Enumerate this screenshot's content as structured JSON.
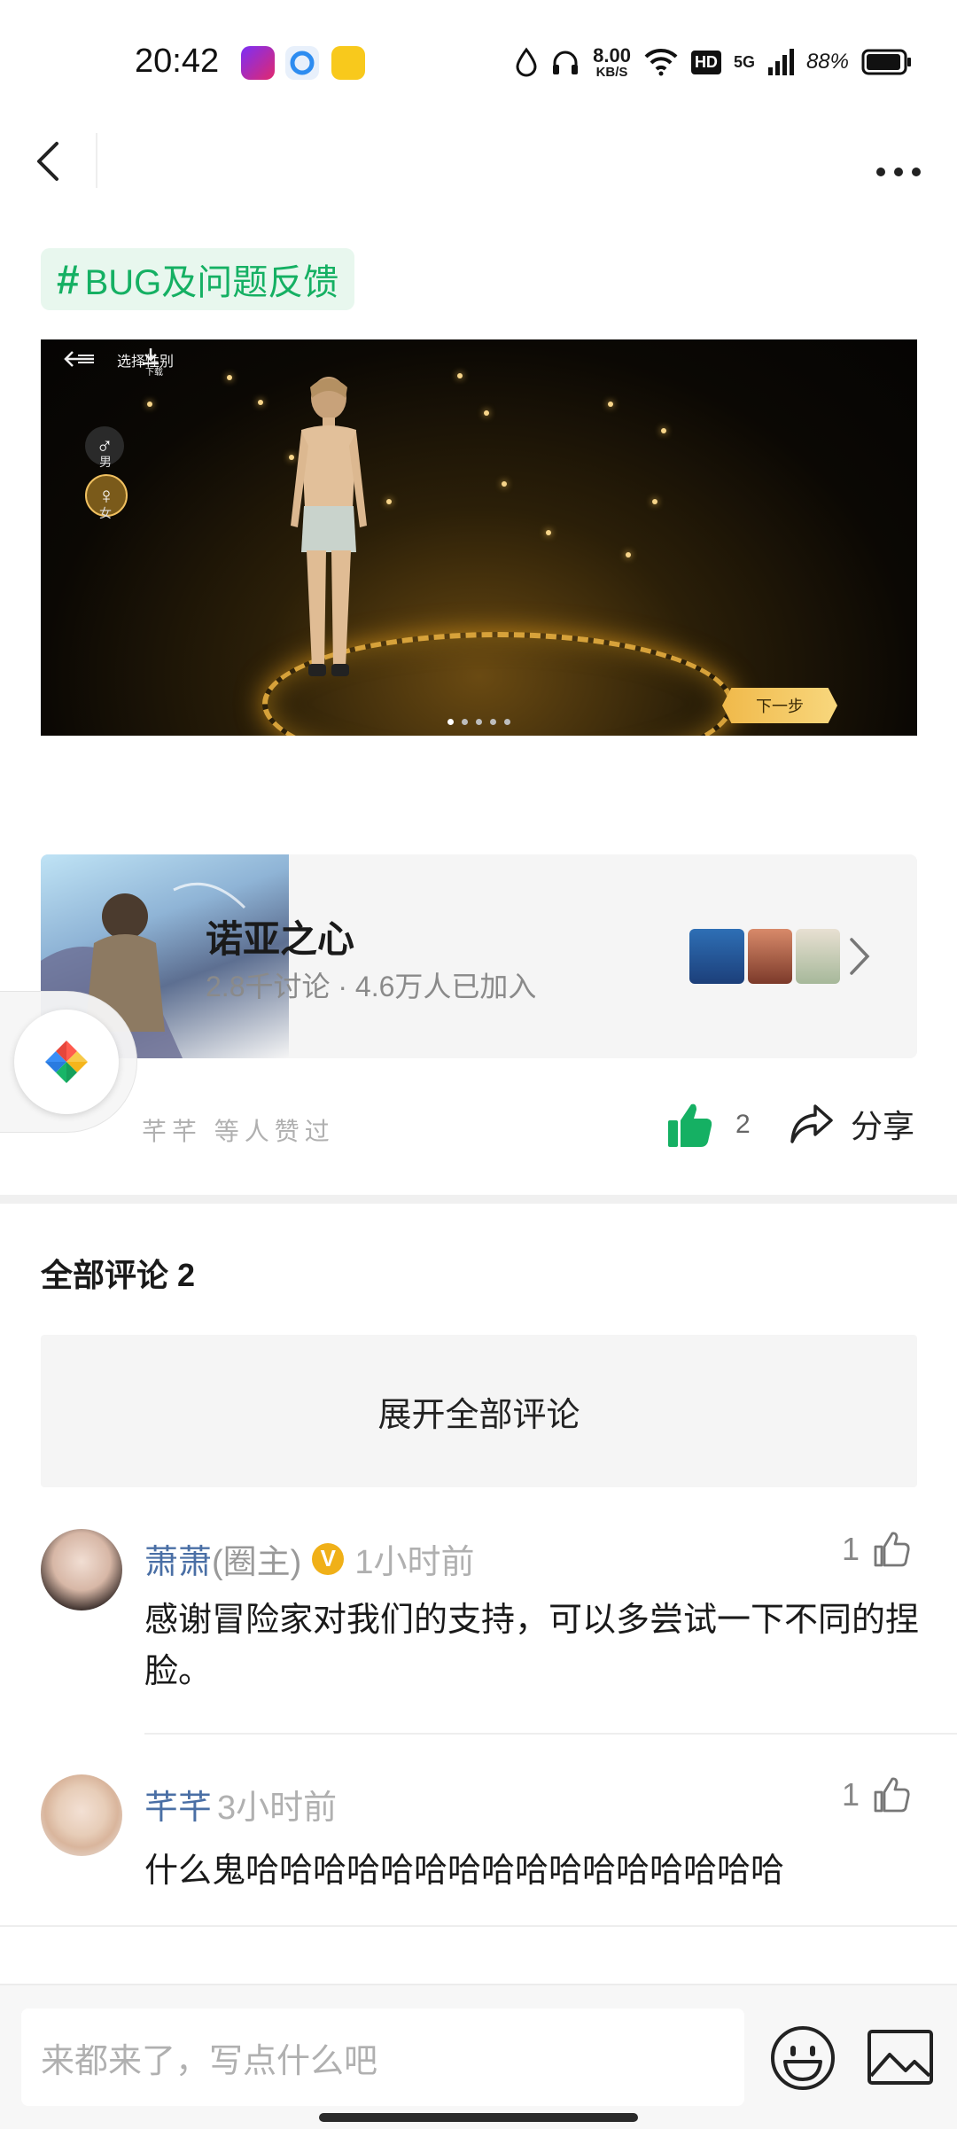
{
  "status_bar": {
    "time": "20:42",
    "net_speed_value": "8.00",
    "net_speed_unit": "KB/S",
    "hd": "HD",
    "network": "5G",
    "battery": "88%"
  },
  "topic": {
    "hash": "#",
    "label": "BUG及问题反馈"
  },
  "media": {
    "back_label": "选择性别",
    "download_label": "下载",
    "male_label": "男",
    "female_label": "女",
    "next_label": "下一步",
    "page_count": 5,
    "active_page": 1
  },
  "community": {
    "name": "诺亚之心",
    "stats": "2.8千讨论 · 4.6万人已加入"
  },
  "actions": {
    "liked_by": "芊芊 等人赞过",
    "like_count": "2",
    "share_label": "分享"
  },
  "comments": {
    "title": "全部评论 2",
    "expand_label": "展开全部评论",
    "items": [
      {
        "name": "萧萧",
        "role": "(圈主)",
        "time": "1小时前",
        "likes": "1",
        "text": "感谢冒险家对我们的支持，可以多尝试一下不同的捏脸。"
      },
      {
        "name": "芊芊",
        "role": "",
        "time": "3小时前",
        "likes": "1",
        "text": "什么鬼哈哈哈哈哈哈哈哈哈哈哈哈哈哈哈哈"
      }
    ]
  },
  "composer": {
    "placeholder": "来都来了，写点什么吧"
  },
  "colors": {
    "accent_green": "#15b063",
    "username_blue": "#4a6fa5",
    "verified_gold": "#f0b018"
  }
}
